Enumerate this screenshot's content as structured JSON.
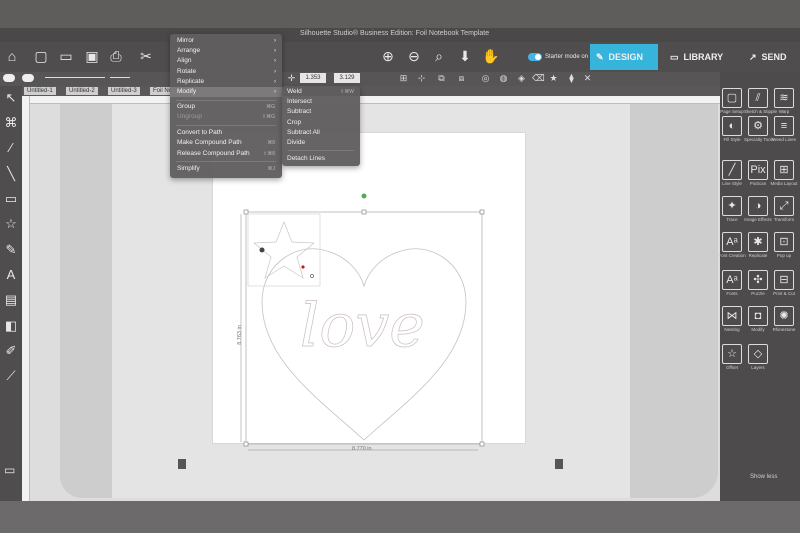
{
  "window": {
    "title": "Silhouette Studio® Business Edition: Foil Notebook Template"
  },
  "toolbar": {
    "icons": [
      "home-icon",
      "new-icon",
      "open-icon",
      "save-icon",
      "print-icon",
      "cut-icon",
      "copy-icon",
      "paste-icon",
      "zoom-in-icon",
      "zoom-out-icon",
      "zoom-select-icon",
      "fit-page-icon",
      "pan-icon"
    ]
  },
  "mode": {
    "label": "Starter mode on",
    "enabled": true
  },
  "tabs": {
    "design": "DESIGN",
    "library": "LIBRARY",
    "send": "SEND"
  },
  "properties": {
    "width_value": "1.353",
    "height_value": "3.129"
  },
  "doc_tabs": [
    "Untitled-1",
    "Untitled-2",
    "Untitled-3",
    "Foil No"
  ],
  "object_menu": {
    "items": [
      {
        "label": "Mirror",
        "submenu": true
      },
      {
        "label": "Arrange",
        "submenu": true
      },
      {
        "label": "Align",
        "submenu": true
      },
      {
        "label": "Rotate",
        "submenu": true
      },
      {
        "label": "Replicate",
        "submenu": true
      },
      {
        "label": "Modify",
        "submenu": true,
        "active": true
      },
      {
        "label": "Group",
        "shortcut": "⌘G"
      },
      {
        "label": "Ungroup",
        "shortcut": "⇧⌘G",
        "disabled": true
      },
      {
        "label": "Convert to Path"
      },
      {
        "label": "Make Compound Path",
        "shortcut": "⌘8"
      },
      {
        "label": "Release Compound Path",
        "shortcut": "⇧⌘8"
      },
      {
        "label": "Simplify",
        "shortcut": "⌘J"
      }
    ]
  },
  "modify_submenu": {
    "items": [
      {
        "label": "Weld",
        "shortcut": "⇧⌘W"
      },
      {
        "label": "Intersect"
      },
      {
        "label": "Subtract"
      },
      {
        "label": "Crop"
      },
      {
        "label": "Subtract All"
      },
      {
        "label": "Divide"
      },
      {
        "label": "Detach Lines"
      }
    ]
  },
  "canvas": {
    "design_text": "love",
    "height_dim": "8.763 in",
    "width_dim": "8.770 in"
  },
  "right_panel": {
    "items": [
      {
        "label": "Page Setup",
        "icon": "page-setup-icon"
      },
      {
        "label": "Sketch & Stipple",
        "icon": "sketch-icon"
      },
      {
        "label": "Warp",
        "icon": "warp-icon"
      },
      {
        "label": "Fill Style",
        "icon": "fill-style-icon"
      },
      {
        "label": "Specialty Tools",
        "icon": "specialty-tools-icon"
      },
      {
        "label": "Weed Lines",
        "icon": "weed-lines-icon"
      },
      {
        "label": "Line Style",
        "icon": "line-style-icon"
      },
      {
        "label": "PixScan",
        "icon": "pixscan-icon"
      },
      {
        "label": "Media Layout",
        "icon": "media-layout-icon"
      },
      {
        "label": "Trace",
        "icon": "trace-icon"
      },
      {
        "label": "Image Effects",
        "icon": "image-effects-icon"
      },
      {
        "label": "Transform",
        "icon": "transform-icon"
      },
      {
        "label": "Font Creation",
        "icon": "font-creation-icon"
      },
      {
        "label": "Replicate",
        "icon": "replicate-icon"
      },
      {
        "label": "Pop up",
        "icon": "pop-up-icon"
      },
      {
        "label": "Fonts",
        "icon": "fonts-icon"
      },
      {
        "label": "Puzzle",
        "icon": "puzzle-icon"
      },
      {
        "label": "Print & Cut",
        "icon": "print-cut-icon"
      },
      {
        "label": "Nesting",
        "icon": "nesting-icon"
      },
      {
        "label": "Modify",
        "icon": "modify-icon"
      },
      {
        "label": "Rhinestone",
        "icon": "rhinestone-icon"
      },
      {
        "label": "Offset",
        "icon": "offset-icon"
      },
      {
        "label": "Layers",
        "icon": "layers-icon"
      }
    ],
    "show_less": "Show less"
  },
  "colors": {
    "accent": "#37b4dc",
    "panel": "#4d4b4b",
    "menu": "#605e5e"
  }
}
